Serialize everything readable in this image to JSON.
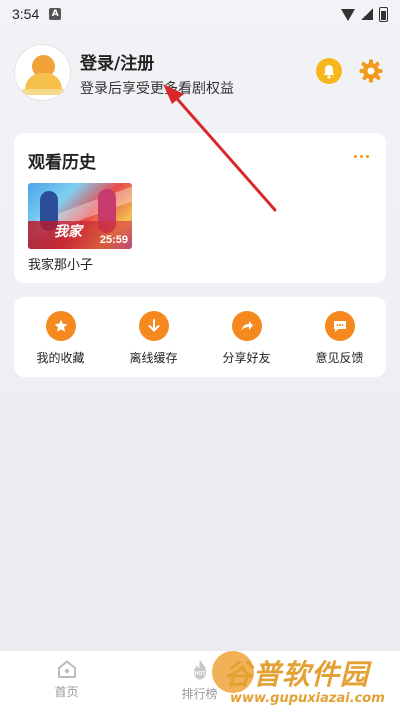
{
  "status_bar": {
    "time": "3:54",
    "notification_badge": "A"
  },
  "profile": {
    "login_label": "登录/注册",
    "login_subtitle": "登录后享受更多看剧权益",
    "icons": {
      "bell": "bell-icon",
      "settings": "gear-icon"
    },
    "colors": {
      "bell_bg": "#f8b51c",
      "gear": "#f39a1c"
    }
  },
  "history": {
    "title": "观看历史",
    "items": [
      {
        "title": "我家那小子",
        "overlay_text": "25:59",
        "overlay_mark": "我家"
      }
    ]
  },
  "actions": [
    {
      "label": "我的收藏",
      "icon": "star-icon"
    },
    {
      "label": "离线缓存",
      "icon": "download-icon"
    },
    {
      "label": "分享好友",
      "icon": "share-icon"
    },
    {
      "label": "意见反馈",
      "icon": "feedback-icon"
    }
  ],
  "bottom_nav": [
    {
      "label": "首页",
      "icon": "home-icon"
    },
    {
      "label": "排行榜",
      "icon": "hot-icon"
    }
  ],
  "watermark": {
    "text": "谷普软件园",
    "url": "www.gupuxiazai.com"
  },
  "accent_color": "#f5891f"
}
